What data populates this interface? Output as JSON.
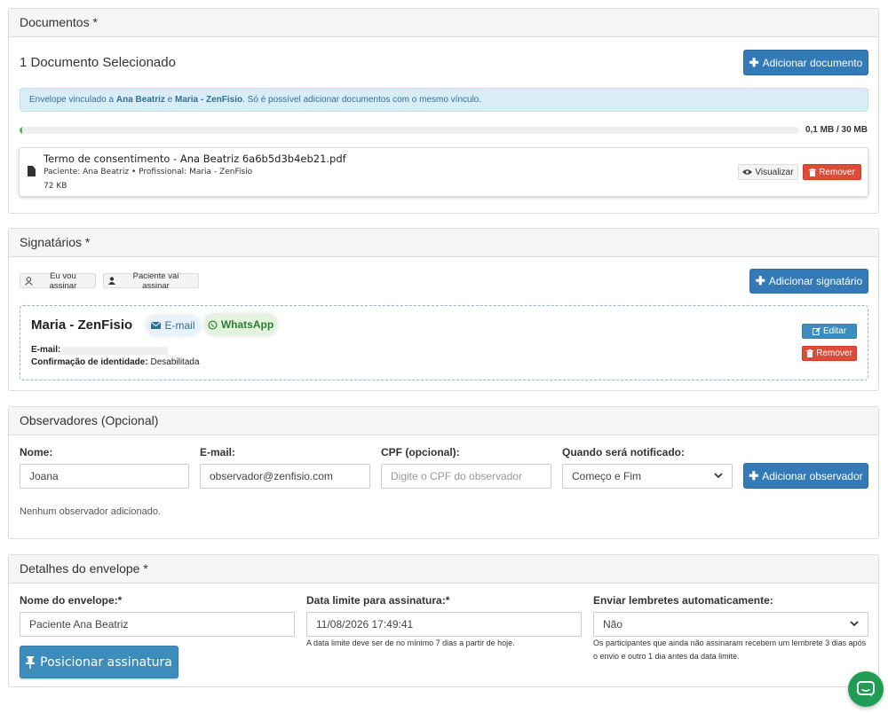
{
  "documentos": {
    "heading": "Documentos *",
    "selected_title": "1 Documento Selecionado",
    "add_button": "Adicionar documento",
    "info": {
      "prefix": "Envelope vinculado a ",
      "patient": "Ana Beatriz",
      "joiner": " e ",
      "professional": "Maria - ZenFisio",
      "suffix": ". Só é possível adicionar documentos com o mesmo vínculo."
    },
    "quota_text": "0,1 MB / 30 MB",
    "quota_fraction": 0.0033,
    "file": {
      "name": "Termo de consentimento - Ana Beatriz 6a6b5d3b4eb21.pdf",
      "meta": "Paciente: Ana Beatriz • Profissional: Maria - ZenFisio",
      "size": "72 KB",
      "view_label": "Visualizar",
      "remove_label": "Remover"
    }
  },
  "signatarios": {
    "heading": "Signatários *",
    "me_sign_label": "Eu vou assinar",
    "patient_sign_label": "Paciente vai assinar",
    "add_button": "Adicionar signatário",
    "signer": {
      "name": "Maria - ZenFisio",
      "email_pill": "E-mail",
      "whatsapp_pill": "WhatsApp",
      "email_label": "E-mail:",
      "identity_label": "Confirmação de identidade:",
      "identity_value": "Desabilitada",
      "edit_label": "Editar",
      "remove_label": "Remover"
    }
  },
  "observadores": {
    "heading": "Observadores (Opcional)",
    "name_label": "Nome:",
    "name_value": "Joana",
    "email_label": "E-mail:",
    "email_value": "observador@zenfisio.com",
    "cpf_label": "CPF (opcional):",
    "cpf_placeholder": "Digite o CPF do observador",
    "notify_label": "Quando será notificado:",
    "notify_value": "Começo e Fim",
    "add_button": "Adicionar observador",
    "empty_message": "Nenhum observador adicionado."
  },
  "detalhes": {
    "heading": "Detalhes do envelope *",
    "name_label": "Nome do envelope:*",
    "name_value": "Paciente Ana Beatriz",
    "deadline_label": "Data limite para assinatura:*",
    "deadline_value": "11/08/2026 17:49:41",
    "deadline_hint": "A data limite deve ser de no mínimo 7 dias a partir de hoje.",
    "reminder_label": "Enviar lembretes automaticamente:",
    "reminder_value": "Não",
    "reminder_hint": "Os participantes que ainda não assinaram recebem um lembrete 3 dias após o envio e outro 1 dia antes da data limite.",
    "position_button": "Posicionar assinatura"
  },
  "colors": {
    "primary": "#337ab7",
    "danger": "#dd4b39",
    "info_bg": "#d9edf7",
    "chat": "#1f9d55"
  },
  "icons": [
    "plus-icon",
    "file-icon",
    "eye-icon",
    "trash-icon",
    "user-outline-icon",
    "user-icon",
    "envelope-icon",
    "whatsapp-icon",
    "edit-icon",
    "chevron-down-icon",
    "pin-icon",
    "chat-icon"
  ]
}
